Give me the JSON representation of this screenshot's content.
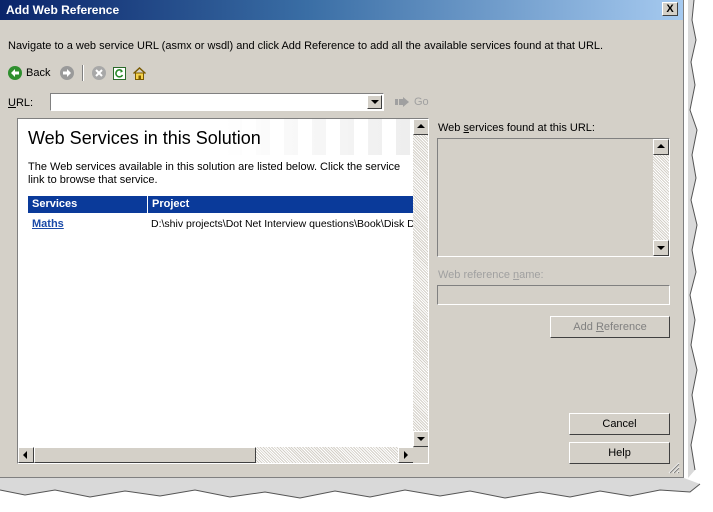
{
  "window": {
    "title": "Add Web Reference",
    "close_label": "X"
  },
  "instructions": "Navigate to a web service URL (asmx or wsdl) and click Add Reference to add all the available services found at that URL.",
  "toolbar": {
    "back_label": "Back",
    "icons": [
      "back-arrow-icon",
      "forward-arrow-icon",
      "stop-icon",
      "refresh-icon",
      "home-icon"
    ]
  },
  "url": {
    "label_underlined": "U",
    "label_rest": "RL:",
    "value": "",
    "go_label": "Go"
  },
  "browser": {
    "heading": "Web Services in this Solution",
    "description": "The Web services available in this solution are listed below. Click the service link to browse that service.",
    "table": {
      "columns": [
        "Services",
        "Project"
      ],
      "rows": [
        {
          "service": "Maths",
          "project": "D:\\shiv projects\\Dot Net Interview questions\\Book\\Disk D"
        }
      ]
    }
  },
  "found_services": {
    "label_pre": "Web ",
    "label_underlined": "s",
    "label_post": "ervices found at this URL:"
  },
  "reference_name": {
    "label_pre": "Web reference ",
    "label_underlined": "n",
    "label_post": "ame:",
    "value": ""
  },
  "buttons": {
    "add_reference_pre": "Add ",
    "add_reference_underlined": "R",
    "add_reference_post": "eference",
    "cancel": "Cancel",
    "help": "Help"
  },
  "colors": {
    "title_bar": "#0a246a",
    "table_header": "#0a3a9a",
    "link": "#1a4aa8",
    "dialog_face": "#d4d0c8"
  }
}
